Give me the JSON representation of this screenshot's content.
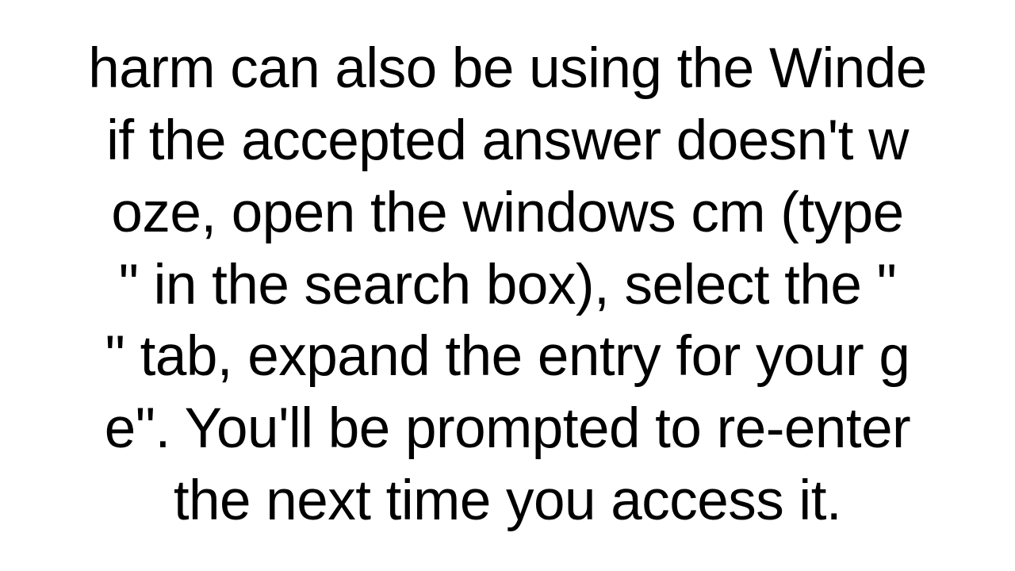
{
  "paragraph": {
    "text": "harm can also be using the Winde\nif the accepted answer doesn't w\noze, open the windows cm (type\n\" in the search box), select the \"\n\" tab, expand the entry for your g\ne\". You'll be prompted to re-enter\nthe next time you access it."
  }
}
